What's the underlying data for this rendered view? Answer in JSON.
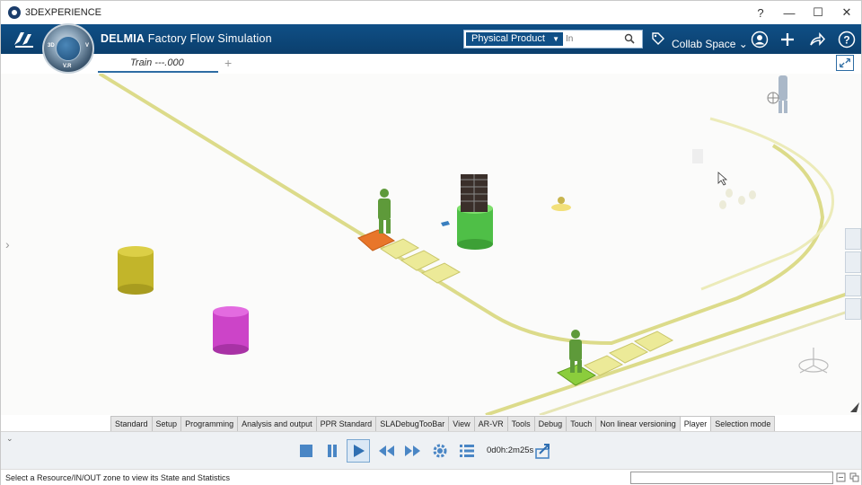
{
  "window": {
    "title": "3DEXPERIENCE",
    "controls": [
      "?",
      "—",
      "☐",
      "✕"
    ]
  },
  "topbar": {
    "app_name_bold": "DELMIA",
    "app_name_rest": " Factory Flow Simulation",
    "compass_labels": [
      "3D",
      "V",
      "V.R"
    ],
    "search_scope": "Physical Product",
    "search_placeholder": "In",
    "collab_space": "Collab Space"
  },
  "tabs": {
    "active_tab": "Train ---.000",
    "add_label": "+"
  },
  "viewport": {
    "colors": {
      "floor": "#fbfbfa",
      "track": "#dcdb8a",
      "conveyor": "#ecea98",
      "operator": "#5e9a3a",
      "green_cylinder": "#4fbf47",
      "yellow_cylinder": "#c2b52a",
      "magenta_cylinder": "#cc44c8",
      "orange_station": "#e8762a"
    }
  },
  "workshop_tabs": [
    "Standard",
    "Setup",
    "Programming",
    "Analysis and output",
    "PPR Standard",
    "SLADebugTooBar",
    "View",
    "AR-VR",
    "Tools",
    "Debug",
    "Touch",
    "Non linear versioning",
    "Player",
    "Selection mode"
  ],
  "active_workshop_tab": "Player",
  "player": {
    "controls": [
      "stop-icon",
      "pause-icon",
      "play-icon",
      "rewind-icon",
      "fast-forward-icon",
      "settings-icon",
      "list-icon",
      "export-icon"
    ],
    "elapsed": "0d0h:2m25s"
  },
  "status": {
    "message": "Select a Resource/IN/OUT zone to view its State and Statistics"
  }
}
